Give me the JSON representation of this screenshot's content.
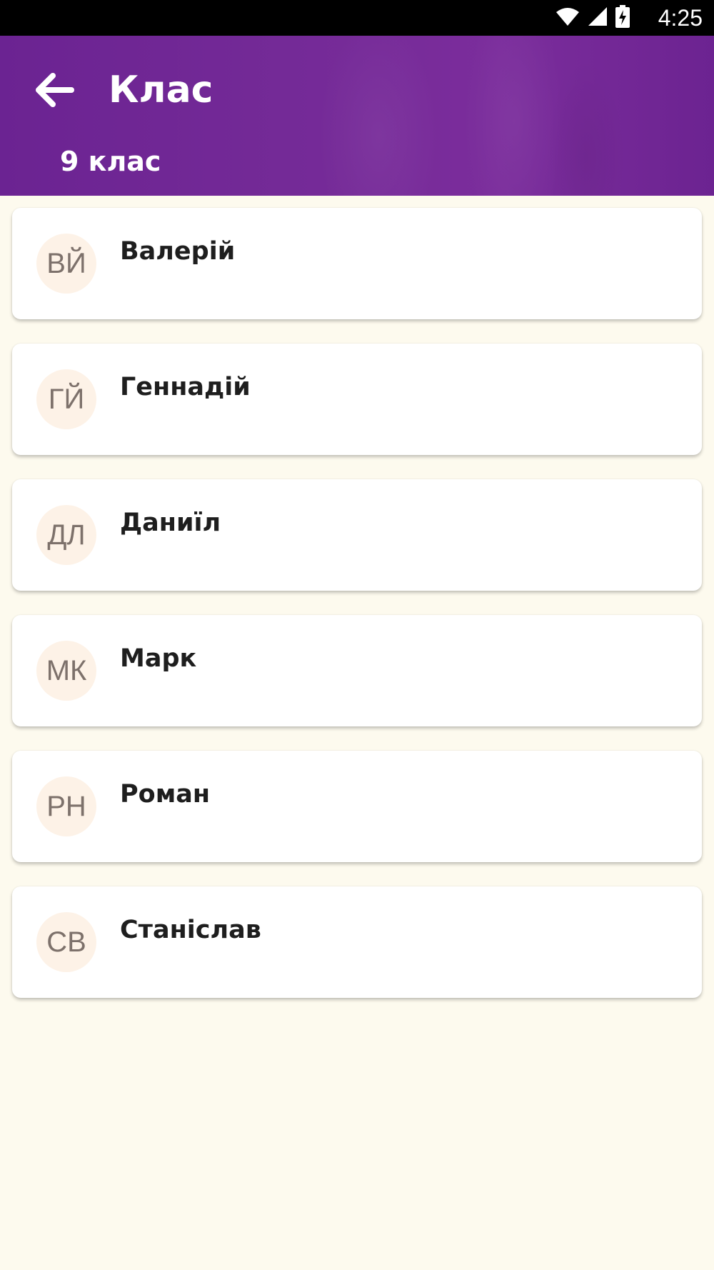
{
  "status_bar": {
    "time": "4:25",
    "icons": [
      "wifi-icon",
      "cell-signal-icon",
      "battery-charging-icon"
    ]
  },
  "header": {
    "title": "Клас",
    "subtitle": "9 клас",
    "back_icon": "arrow-left-icon"
  },
  "students": [
    {
      "initials": "ВЙ",
      "name": "Валерій"
    },
    {
      "initials": "ГЙ",
      "name": "Геннадій"
    },
    {
      "initials": "ДЛ",
      "name": "Даниїл"
    },
    {
      "initials": "МК",
      "name": "Марк"
    },
    {
      "initials": "РН",
      "name": "Роман"
    },
    {
      "initials": "СВ",
      "name": "Станіслав"
    }
  ],
  "colors": {
    "app_bar": "#742a97",
    "background": "#fdfaee",
    "avatar_bg": "#fdf2e7",
    "avatar_text": "#7d716b"
  }
}
